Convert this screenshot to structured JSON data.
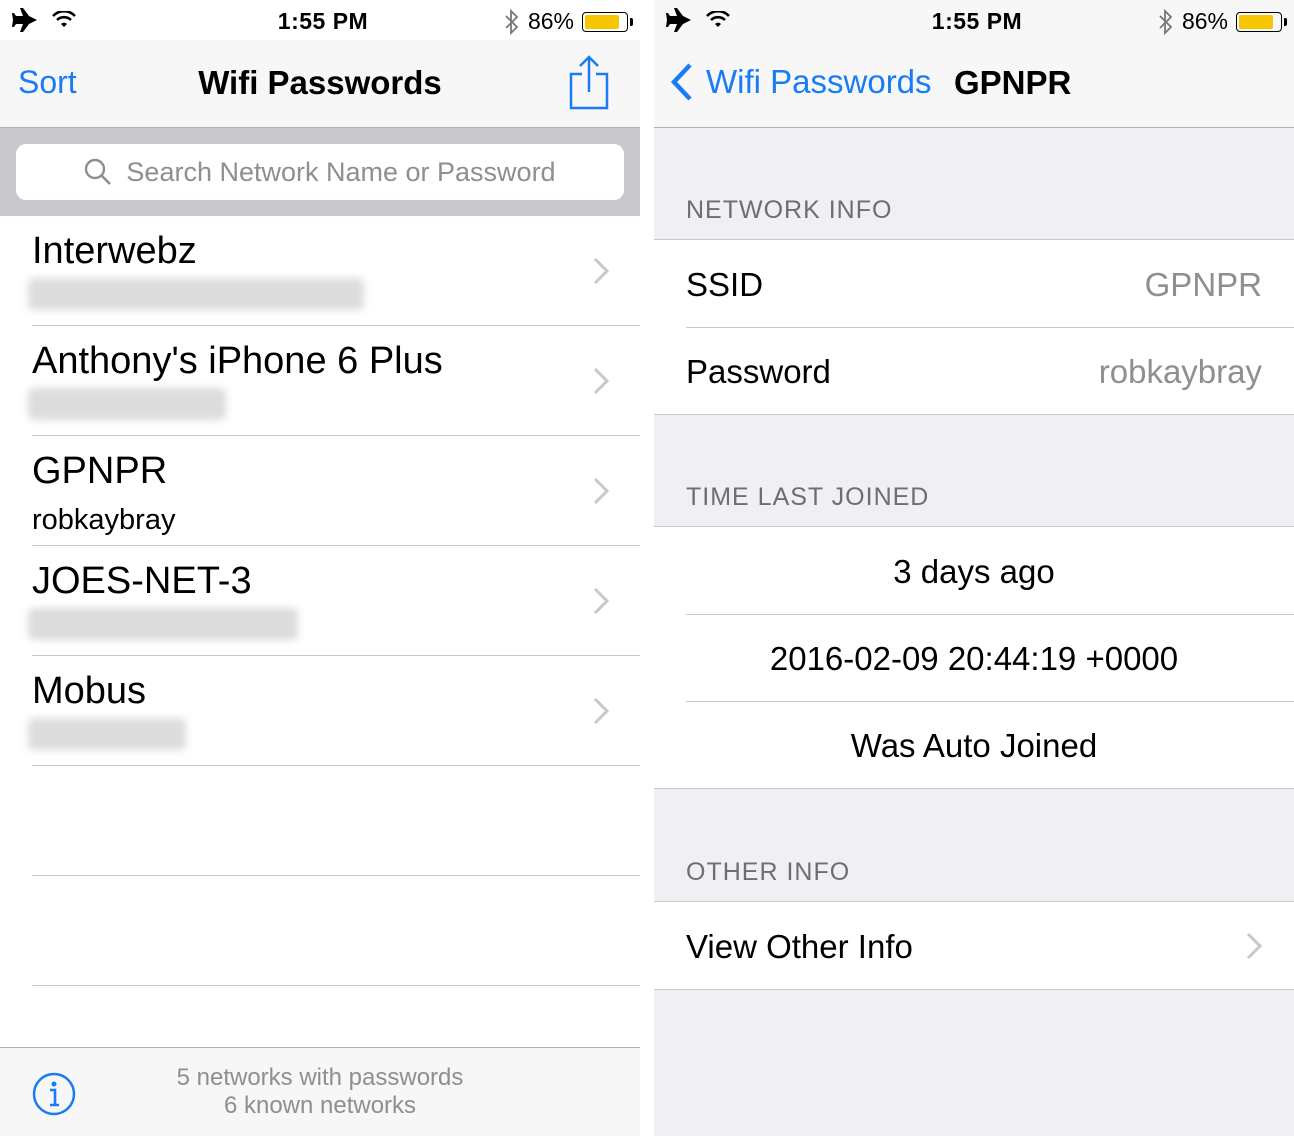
{
  "left": {
    "status": {
      "time": "1:55 PM",
      "battery": "86%",
      "battery_level": 0.86
    },
    "nav": {
      "sort_label": "Sort",
      "title": "Wifi Passwords"
    },
    "search": {
      "placeholder": "Search Network Name or Password"
    },
    "networks": [
      {
        "name": "Interwebz",
        "password": ""
      },
      {
        "name": "Anthony's iPhone 6 Plus",
        "password": ""
      },
      {
        "name": "GPNPR",
        "password": "robkaybray"
      },
      {
        "name": "JOES-NET-3",
        "password": ""
      },
      {
        "name": "Mobus",
        "password": ""
      }
    ],
    "toolbar": {
      "line1": "5 networks with passwords",
      "line2": "6 known networks"
    }
  },
  "right": {
    "status": {
      "time": "1:55 PM",
      "battery": "86%",
      "battery_level": 0.86
    },
    "nav": {
      "back_label": "Wifi Passwords",
      "title": "GPNPR"
    },
    "network_info": {
      "header": "NETWORK INFO",
      "ssid_label": "SSID",
      "ssid_value": "GPNPR",
      "password_label": "Password",
      "password_value": "robkaybray"
    },
    "time_last_joined": {
      "header": "TIME LAST JOINED",
      "relative": "3 days ago",
      "timestamp": "2016-02-09 20:44:19 +0000",
      "auto_joined": "Was Auto Joined"
    },
    "other_info": {
      "header": "OTHER INFO",
      "view_label": "View Other Info"
    }
  },
  "colors": {
    "accent": "#1a7cf5",
    "battery": "#f6c700",
    "secondary_text": "#8e8e93",
    "group_bg": "#efeff4"
  }
}
